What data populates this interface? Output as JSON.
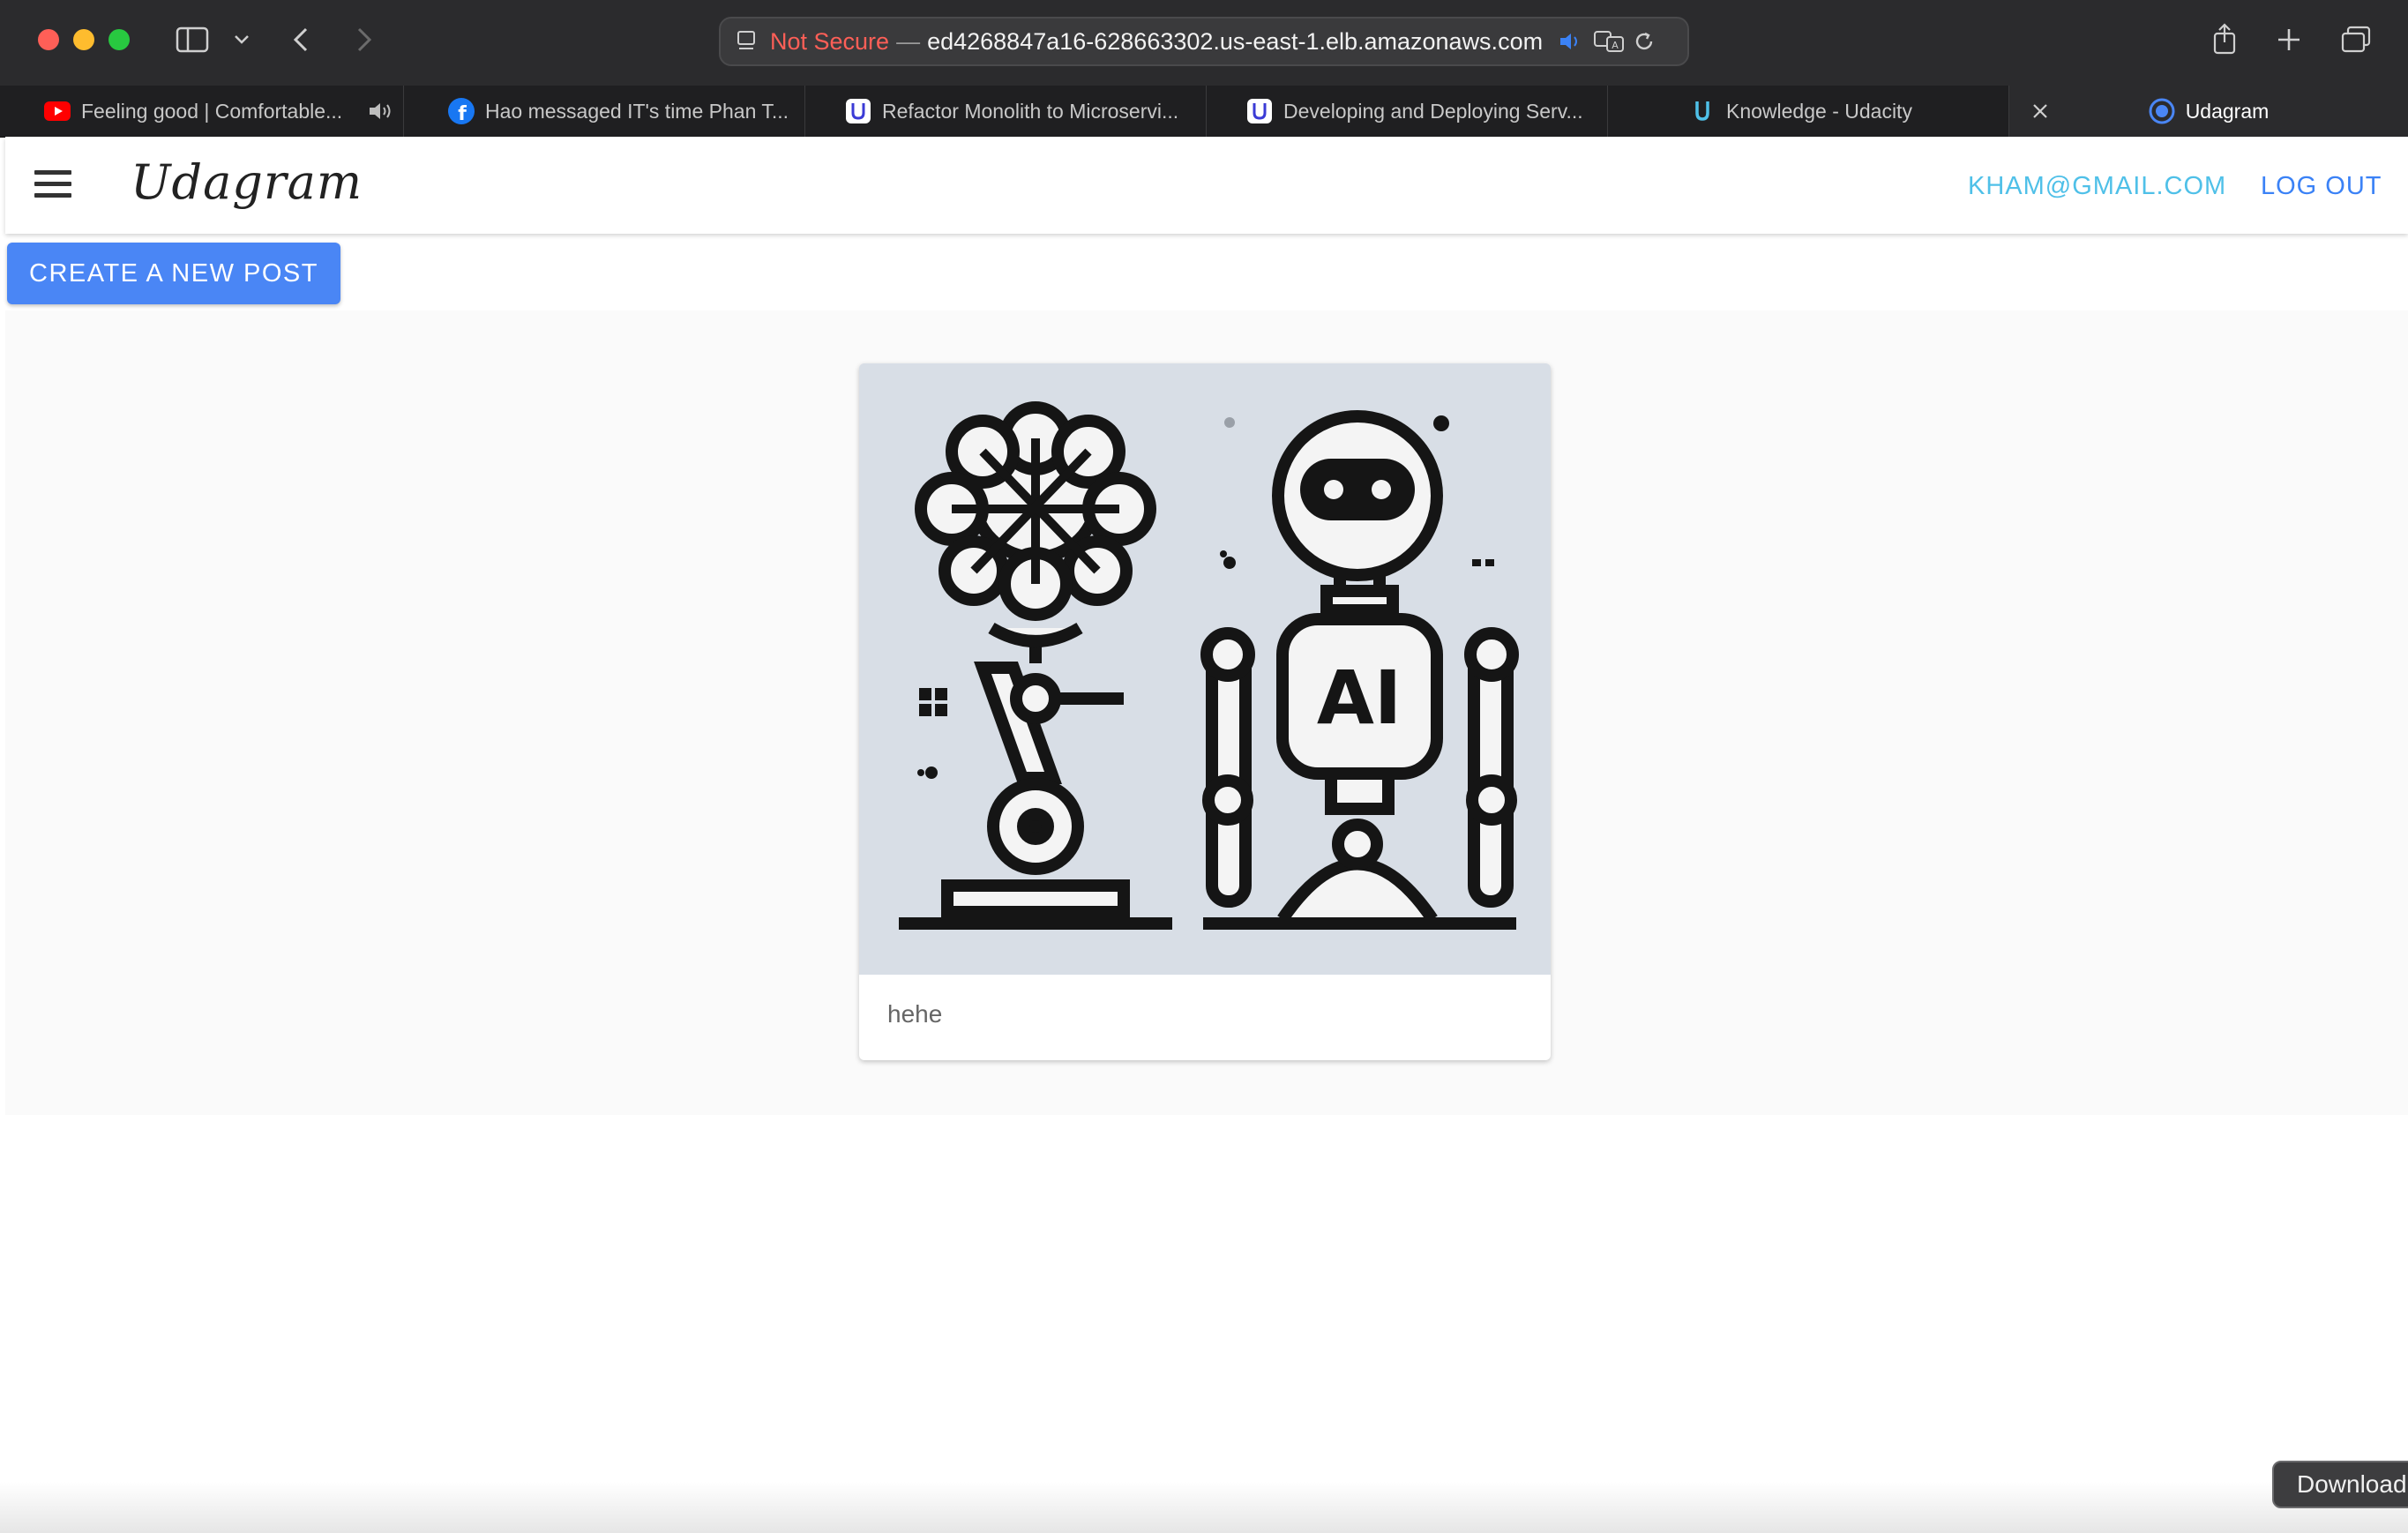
{
  "browser": {
    "url_security": "Not Secure",
    "url_separator": "—",
    "url_host": "ed4268847a16-628663302.us-east-1.elb.amazonaws.com",
    "tabs": [
      {
        "label": "Feeling good | Comfortable...",
        "icon": "youtube-icon"
      },
      {
        "label": "Hao messaged IT's time Phan T...",
        "icon": "facebook-icon"
      },
      {
        "label": "Refactor Monolith to Microservi...",
        "icon": "udacity-icon"
      },
      {
        "label": "Developing and Deploying Serv...",
        "icon": "udacity-icon"
      },
      {
        "label": "Knowledge - Udacity",
        "icon": "udacity-icon"
      },
      {
        "label": "Udagram",
        "icon": "udagram-icon",
        "active": true
      }
    ]
  },
  "app": {
    "brand": "Udagram",
    "user_email": "KHAM@GMAIL.COM",
    "logout_label": "LOG OUT",
    "create_post_label": "CREATE A NEW POST"
  },
  "feed": {
    "posts": [
      {
        "caption": "hehe",
        "image": "ai-robot-brain-illustration"
      }
    ]
  },
  "tooltip": {
    "download_label": "Download"
  },
  "colors": {
    "accent": "#4a86f5",
    "email_link": "#4fc0e8",
    "logout_link": "#3b82f6",
    "not_secure": "#ff5f57"
  }
}
